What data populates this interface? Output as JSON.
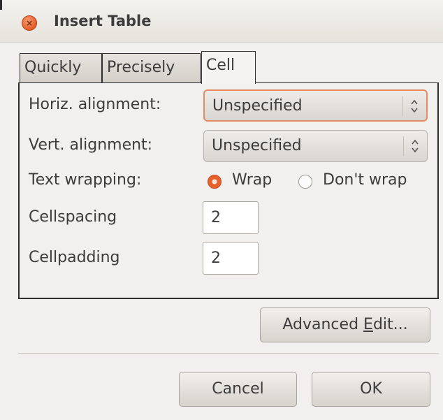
{
  "window": {
    "title": "Insert Table"
  },
  "tabs": [
    {
      "label": "Quickly"
    },
    {
      "label": "Precisely"
    },
    {
      "label": "Cell",
      "active": true
    }
  ],
  "cell": {
    "horiz_label": "Horiz. alignment:",
    "horiz_value": "Unspecified",
    "vert_label": "Vert. alignment:",
    "vert_value": "Unspecified",
    "wrap_label": "Text wrapping:",
    "wrap_option": "Wrap",
    "nowrap_option": "Don't wrap",
    "wrap_selected": "Wrap",
    "cellspacing_label": "Cellspacing",
    "cellspacing_value": "2",
    "cellpadding_label": "Cellpadding",
    "cellpadding_value": "2"
  },
  "advanced": {
    "prefix": "Advanced ",
    "mnemonic": "E",
    "suffix": "dit..."
  },
  "buttons": {
    "cancel": "Cancel",
    "ok": "OK"
  },
  "colors": {
    "accent": "#e8612c",
    "focus_border": "#e38c62",
    "window_bg": "#f1f0ee"
  },
  "icons": {
    "close": "close-icon",
    "combo_arrows": "updown-arrows-icon"
  }
}
